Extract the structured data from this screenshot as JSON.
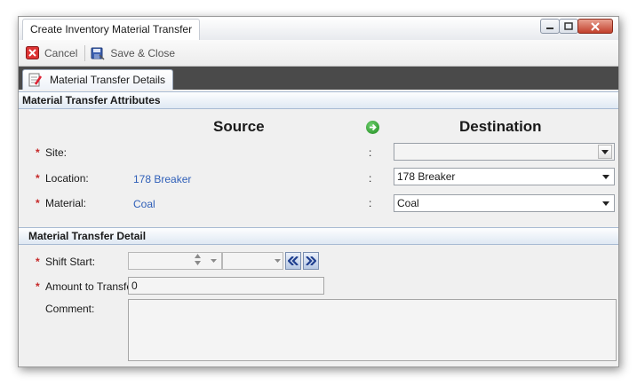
{
  "window": {
    "title": "Create Inventory Material Transfer"
  },
  "toolbar": {
    "cancel_label": "Cancel",
    "save_close_label": "Save & Close"
  },
  "tabs": [
    {
      "label": "Material Transfer Details"
    }
  ],
  "attributes": {
    "header": "Material Transfer Attributes",
    "source_heading": "Source",
    "destination_heading": "Destination",
    "required_marker": "*",
    "separator": ":",
    "rows": [
      {
        "label": "Site:",
        "source": "",
        "destination": ""
      },
      {
        "label": "Location:",
        "source": "178 Breaker",
        "destination": "178 Breaker"
      },
      {
        "label": "Material:",
        "source": "Coal",
        "destination": "Coal"
      }
    ]
  },
  "detail": {
    "header": "Material Transfer Detail",
    "shift_start_label": "Shift Start:",
    "amount_label": "Amount to Transfer:",
    "amount_value": "0",
    "comment_label": "Comment:",
    "comment_value": ""
  },
  "colors": {
    "required": "#c62828",
    "source_value": "#2f5fb8",
    "tabstrip": "#4a4a4a",
    "section_header_border": "#a8bbd3"
  }
}
